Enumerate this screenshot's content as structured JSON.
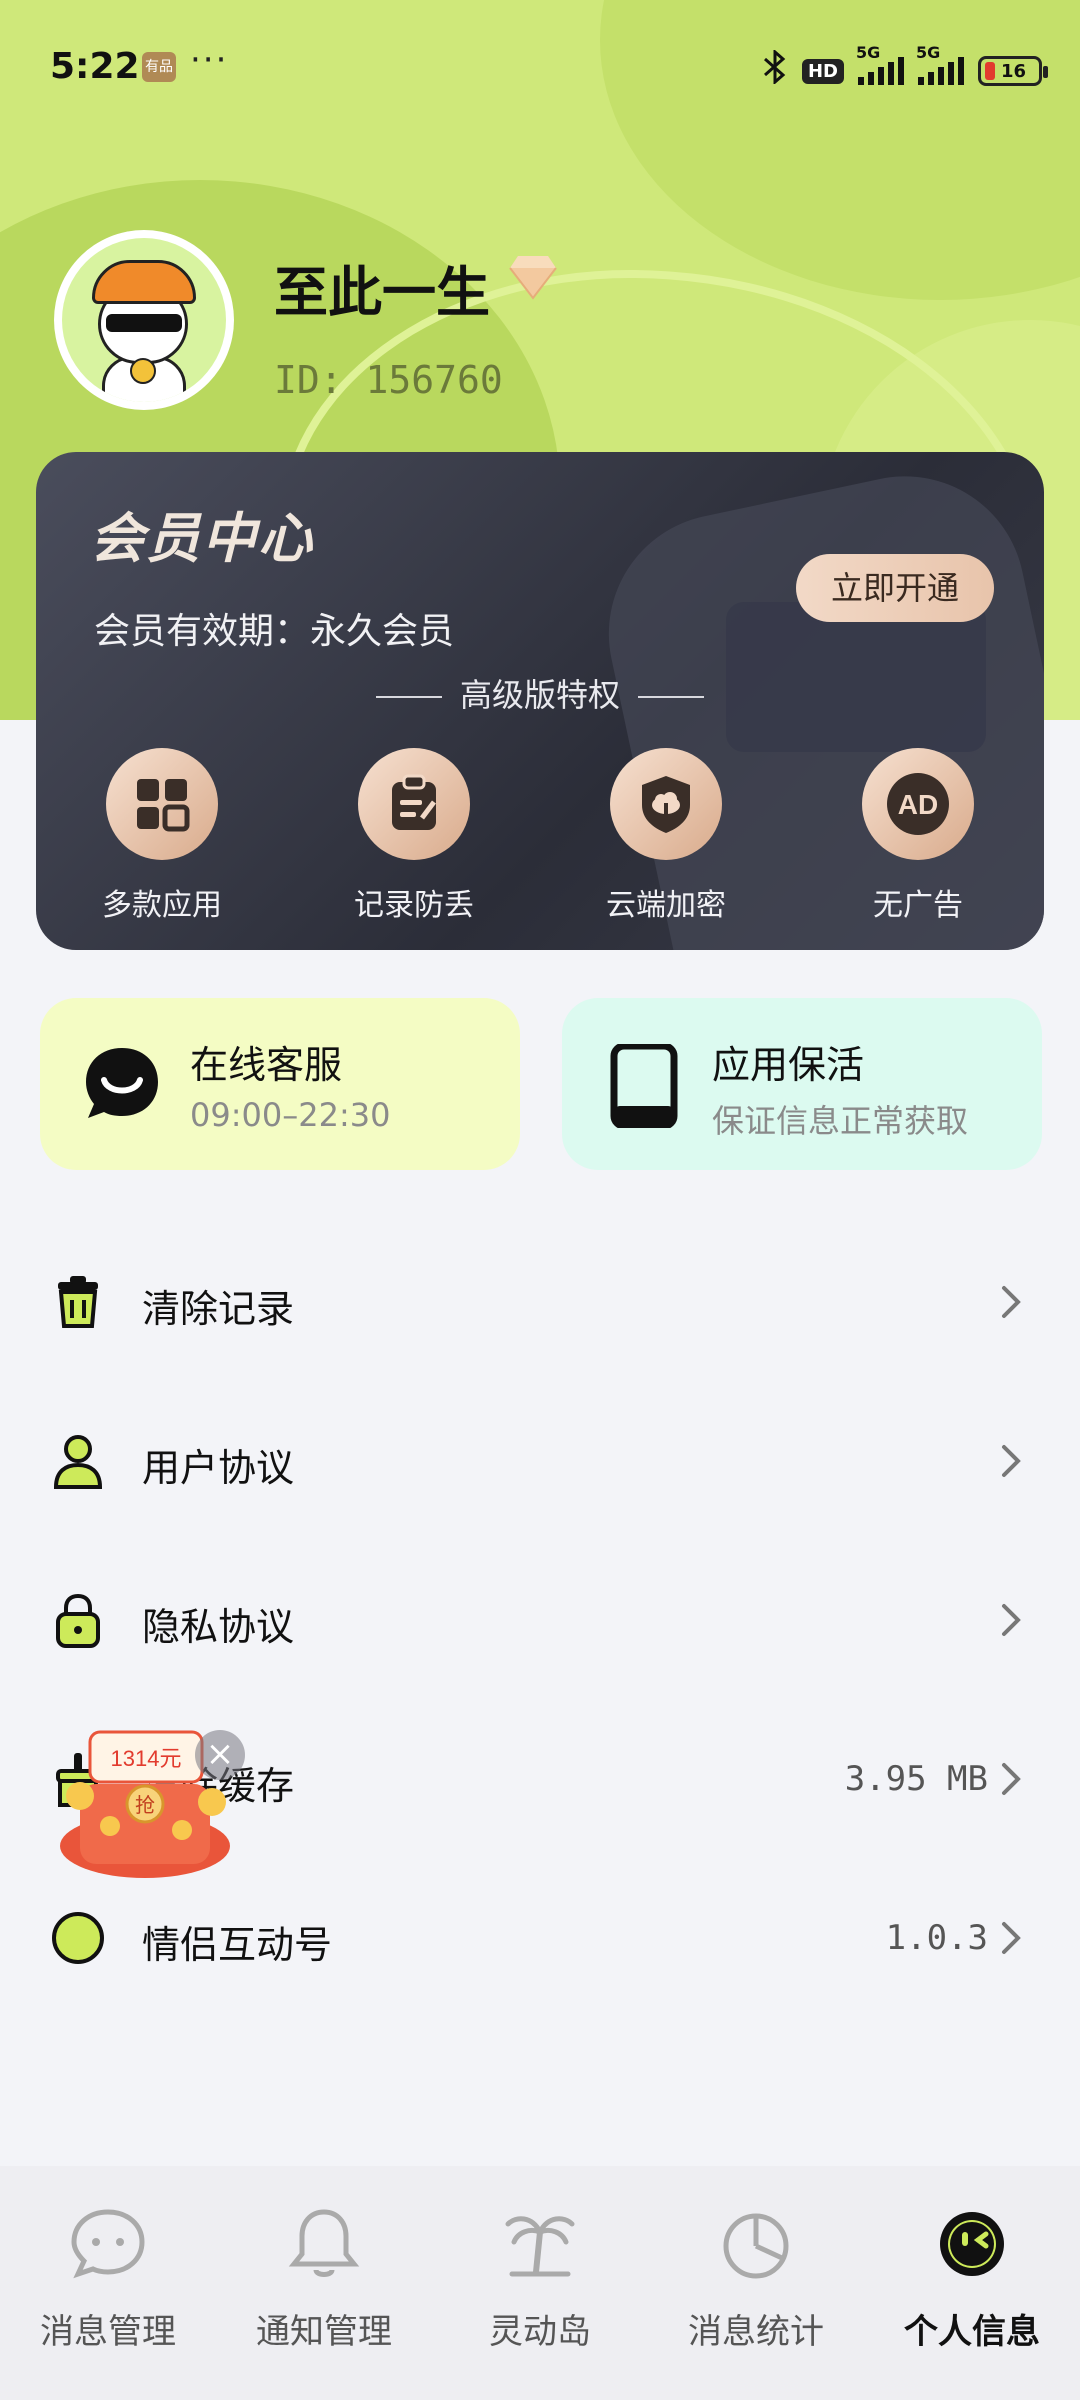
{
  "status_bar": {
    "time": "5:22",
    "app_badge": "有品",
    "more": "···",
    "hd": "HD",
    "net1": "5G",
    "net2": "5G",
    "battery": "16"
  },
  "profile": {
    "name": "至此一生",
    "id": "ID: 156760"
  },
  "vip": {
    "title": "会员中心",
    "validity": "会员有效期：永久会员",
    "button": "立即开通",
    "subtitle": "高级版特权",
    "perks": [
      {
        "label": "多款应用",
        "icon": "grid-apps-icon"
      },
      {
        "label": "记录防丢",
        "icon": "clipboard-edit-icon"
      },
      {
        "label": "云端加密",
        "icon": "cloud-shield-icon"
      },
      {
        "label": "无广告",
        "icon": "ad-icon"
      }
    ],
    "ad_mark": "AD"
  },
  "services": [
    {
      "title": "在线客服",
      "subtitle": "09:00–22:30",
      "icon": "chat-bubble-icon",
      "bg": "#f4fcc4"
    },
    {
      "title": "应用保活",
      "subtitle": "保证信息正常获取",
      "icon": "tablet-icon",
      "bg": "#dcfaf0"
    }
  ],
  "menu": [
    {
      "label": "清除记录",
      "value": "",
      "icon": "trash-icon"
    },
    {
      "label": "用户协议",
      "value": "",
      "icon": "user-icon"
    },
    {
      "label": "隐私协议",
      "value": "",
      "icon": "lock-icon"
    },
    {
      "label": "清除缓存",
      "value": "3.95 MB",
      "icon": "broom-icon"
    },
    {
      "label": "情侣互动号",
      "value": "1.0.3",
      "icon": "info-icon"
    }
  ],
  "floating_ad": {
    "amount": "1314元",
    "grab": "抢",
    "close": "×"
  },
  "tabs": [
    {
      "label": "消息管理",
      "icon": "message-icon",
      "active": false
    },
    {
      "label": "通知管理",
      "icon": "bell-icon",
      "active": false
    },
    {
      "label": "灵动岛",
      "icon": "palm-island-icon",
      "active": false
    },
    {
      "label": "消息统计",
      "icon": "pie-chart-icon",
      "active": false
    },
    {
      "label": "个人信息",
      "icon": "face-icon",
      "active": true
    }
  ],
  "colors": {
    "accent": "#cfe87a",
    "card_dark": "#2b2d38",
    "gold": "#e8c4ab"
  }
}
